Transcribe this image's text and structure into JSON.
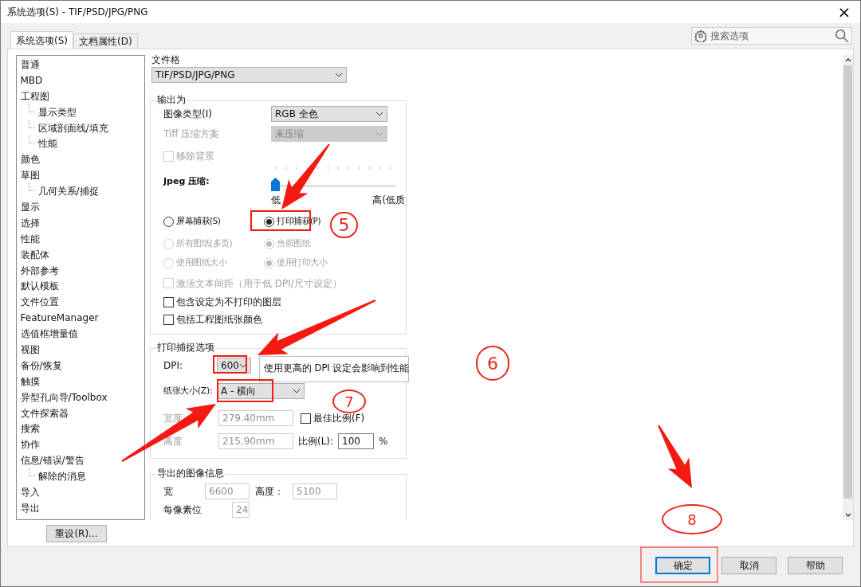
{
  "window": {
    "title": "系统选项(S) - TIF/PSD/JPG/PNG",
    "close": "×"
  },
  "tabs": [
    {
      "label": "系统选项(S)",
      "selected": true
    },
    {
      "label": "文档属性(D)",
      "selected": false
    }
  ],
  "search": {
    "placeholder": "搜索选项"
  },
  "tree": [
    {
      "label": "普通"
    },
    {
      "label": "MBD"
    },
    {
      "label": "工程图",
      "children": [
        {
          "label": "显示类型"
        },
        {
          "label": "区域剖面线/填充"
        },
        {
          "label": "性能"
        }
      ]
    },
    {
      "label": "颜色"
    },
    {
      "label": "草图",
      "children": [
        {
          "label": "几何关系/捕捉"
        }
      ]
    },
    {
      "label": "显示"
    },
    {
      "label": "选择"
    },
    {
      "label": "性能"
    },
    {
      "label": "装配体"
    },
    {
      "label": "外部参考"
    },
    {
      "label": "默认模板"
    },
    {
      "label": "文件位置"
    },
    {
      "label": "FeatureManager"
    },
    {
      "label": "选值框增量值"
    },
    {
      "label": "视图"
    },
    {
      "label": "备份/恢复"
    },
    {
      "label": "触摸"
    },
    {
      "label": "异型孔向导/Toolbox"
    },
    {
      "label": "文件探索器"
    },
    {
      "label": "搜索"
    },
    {
      "label": "协作"
    },
    {
      "label": "信息/错误/警告",
      "children": [
        {
          "label": "解除的消息"
        }
      ]
    },
    {
      "label": "导入"
    },
    {
      "label": "导出"
    }
  ],
  "reset_button": "重设(R)...",
  "panel": {
    "file_format": {
      "label": "文件格",
      "value": "TIF/PSD/JPG/PNG"
    },
    "output_group": {
      "title": "输出为",
      "image_type": {
        "label": "图像类型(I)",
        "value": "RGB 全色",
        "disabled": false
      },
      "tiff": {
        "label": "Tiff 压缩方案",
        "value": "未压缩",
        "disabled": true
      },
      "remove_background": {
        "label": "移除背景",
        "checked": false,
        "disabled": true
      },
      "jpeg": {
        "label": "Jpeg 压缩:",
        "level": 0,
        "low_label": "低",
        "high_label": "高(低质"
      },
      "radio_rows": [
        [
          {
            "label": "屏幕捕获(S)",
            "selected": false,
            "disabled": false
          },
          {
            "label": "打印捕获(P)",
            "selected": true,
            "disabled": false
          }
        ],
        [
          {
            "label": "所有图纸(多页)",
            "selected": false,
            "disabled": true
          },
          {
            "label": "当前图纸",
            "selected": true,
            "disabled": true
          }
        ],
        [
          {
            "label": "使用图纸大小",
            "selected": false,
            "disabled": true
          },
          {
            "label": "使用打印大小",
            "selected": true,
            "disabled": true
          }
        ]
      ],
      "checkboxes": [
        {
          "label": "激活文本间距（用于低 DPI/尺寸设定）",
          "checked": false,
          "disabled": true
        },
        {
          "label": "包含设定为不打印的图层",
          "checked": false,
          "disabled": false
        },
        {
          "label": "包括工程图纸张颜色",
          "checked": false,
          "disabled": false
        }
      ]
    },
    "print_group": {
      "title": "打印捕捉选项",
      "dpi": {
        "label": "DPI:",
        "value": "600"
      },
      "tooltip": "使用更高的 DPI 设定会影响到性能",
      "paper": {
        "label": "纸张大小(Z):",
        "value": "A - 横向"
      },
      "width": {
        "label": "宽度",
        "value": "279.40mm",
        "disabled": true
      },
      "best_fit": {
        "label": "最佳比例(F)",
        "checked": false,
        "disabled": false
      },
      "height": {
        "label": "高度",
        "value": "215.90mm",
        "disabled": true
      },
      "scale": {
        "label": "比例(L):",
        "value": "100",
        "unit": "%"
      }
    },
    "image_info_group": {
      "title": "导出的图像信息",
      "width": {
        "label": "宽",
        "value": "6600"
      },
      "height": {
        "label": "高度：",
        "value": "5100"
      },
      "bits": {
        "label": "每像素位",
        "value": "24"
      }
    }
  },
  "buttons": [
    {
      "label": "确定",
      "default": true
    },
    {
      "label": "取消",
      "default": false
    },
    {
      "label": "帮助",
      "default": false
    }
  ],
  "annotations": [
    {
      "text": "5",
      "kind": "circle"
    },
    {
      "text": "6",
      "kind": "circle"
    },
    {
      "text": "7",
      "kind": "ellipse"
    },
    {
      "text": "8",
      "kind": "ellipse"
    }
  ]
}
